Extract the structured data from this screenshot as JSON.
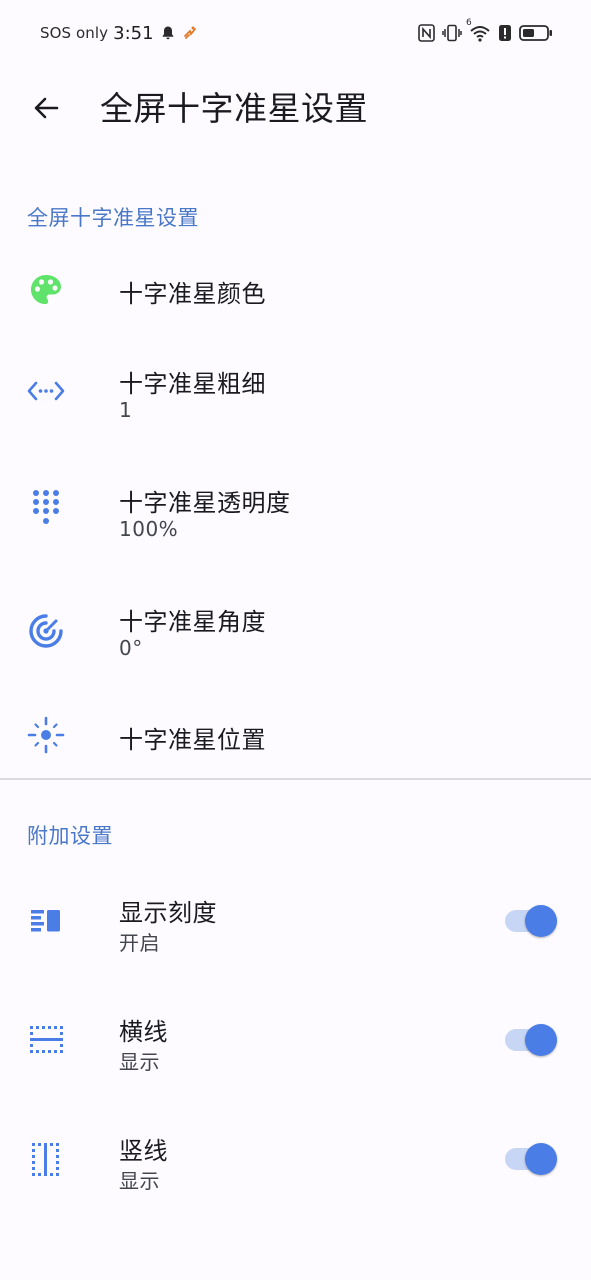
{
  "status_bar": {
    "carrier": "SOS only",
    "time": "3:51",
    "network_label": "6"
  },
  "app_bar": {
    "title": "全屏十字准星设置"
  },
  "sections": [
    {
      "header": "全屏十字准星设置",
      "items": [
        {
          "title": "十字准星颜色",
          "subtitle": null,
          "icon": "palette-icon",
          "icon_color": "#5fe36a"
        },
        {
          "title": "十字准星粗细",
          "subtitle": "1",
          "icon": "line-width-icon",
          "icon_color": "#4a7de6"
        },
        {
          "title": "十字准星透明度",
          "subtitle": "100%",
          "icon": "dialpad-icon",
          "icon_color": "#4a7de6"
        },
        {
          "title": "十字准星角度",
          "subtitle": "0°",
          "icon": "radar-icon",
          "icon_color": "#4a7de6"
        },
        {
          "title": "十字准星位置",
          "subtitle": null,
          "icon": "center-focus-icon",
          "icon_color": "#4a7de6"
        }
      ]
    },
    {
      "header": "附加设置",
      "items": [
        {
          "title": "显示刻度",
          "subtitle": "开启",
          "icon": "scale-icon",
          "toggle_on": true
        },
        {
          "title": "横线",
          "subtitle": "显示",
          "icon": "horizontal-lines-icon",
          "toggle_on": true
        },
        {
          "title": "竖线",
          "subtitle": "显示",
          "icon": "vertical-lines-icon",
          "toggle_on": true
        }
      ]
    }
  ],
  "colors": {
    "accent": "#4a7de6",
    "section_header": "#4a78c8",
    "background": "#FDFBFF",
    "switch_track": "#c7d6f5"
  }
}
